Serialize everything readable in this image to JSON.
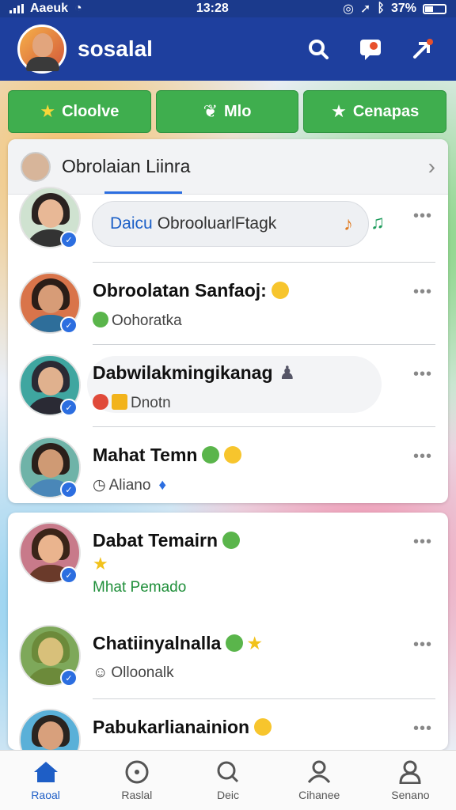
{
  "status_bar": {
    "carrier": "Aaeuk",
    "time": "13:28",
    "battery": "37%"
  },
  "header": {
    "title": "sosalal"
  },
  "filters": [
    {
      "icon": "star-icon",
      "label": "Cloolve"
    },
    {
      "icon": "leaf-icon",
      "label": "Mlo"
    },
    {
      "icon": "star-icon",
      "label": "Cenapas"
    }
  ],
  "card1": {
    "title": "Obrolaian Liinra",
    "rows": [
      {
        "bubble_highlight": "Daicu",
        "bubble_text": "ObrooluarlFtagk"
      },
      {
        "name": "Obroolatan Sanfaoj:",
        "sub": "Oohoratka"
      },
      {
        "name": "Dabwilakmingikanag",
        "sub": "Dnotn"
      },
      {
        "name": "Mahat Temn",
        "sub": "Aliano"
      }
    ]
  },
  "card2": {
    "rows": [
      {
        "name": "Dabat Temairn",
        "sub": "Mhat Pemado"
      },
      {
        "name": "Chatiinyalnalla",
        "sub": "Olloonalk"
      },
      {
        "name": "Pabukarlianainion",
        "sub": ""
      }
    ]
  },
  "bottom_nav": [
    {
      "icon": "home-icon",
      "label": "Raoal",
      "active": true
    },
    {
      "icon": "compass-icon",
      "label": "Raslal",
      "active": false
    },
    {
      "icon": "search-icon",
      "label": "Deic",
      "active": false
    },
    {
      "icon": "people-icon",
      "label": "Cihanee",
      "active": false
    },
    {
      "icon": "profile-icon",
      "label": "Senano",
      "active": false
    }
  ],
  "colors": {
    "header": "#1e3f9e",
    "filter_green": "#3fae4e",
    "accent_blue": "#2c6ee0"
  }
}
